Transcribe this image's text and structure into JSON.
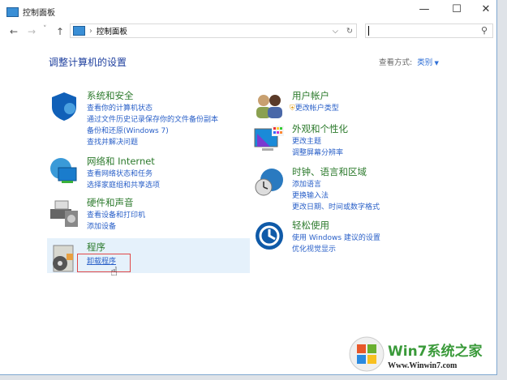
{
  "window": {
    "title": "控制面板",
    "minimize": "—",
    "maximize": "☐",
    "close": "✕"
  },
  "nav": {
    "back": "←",
    "forward": "→",
    "recent": "˅",
    "up": "↑",
    "address": "控制面板",
    "separator": "›",
    "dropdown": "⌵",
    "refresh": "↻",
    "search_placeholder": "",
    "search_icon": "⚲"
  },
  "main": {
    "heading": "调整计算机的设置",
    "view_label": "查看方式:",
    "view_value": "类别",
    "categories": [
      {
        "title": "系统和安全",
        "links": [
          "查看你的计算机状态",
          "通过文件历史记录保存你的文件备份副本",
          "备份和还原(Windows 7)",
          "查找并解决问题"
        ]
      },
      {
        "title": "网络和 Internet",
        "links": [
          "查看网络状态和任务",
          "选择家庭组和共享选项"
        ]
      },
      {
        "title": "硬件和声音",
        "links": [
          "查看设备和打印机",
          "添加设备"
        ]
      },
      {
        "title": "程序",
        "links": [
          "卸载程序"
        ]
      },
      {
        "title": "用户帐户",
        "links": [
          "更改帐户类型"
        ]
      },
      {
        "title": "外观和个性化",
        "links": [
          "更改主题",
          "调整屏幕分辨率"
        ]
      },
      {
        "title": "时钟、语言和区域",
        "links": [
          "添加语言",
          "更换输入法",
          "更改日期、时间或数字格式"
        ]
      },
      {
        "title": "轻松使用",
        "links": [
          "使用 Windows 建议的设置",
          "优化视觉显示"
        ]
      }
    ]
  },
  "watermark": {
    "brand": "Win7系统之家",
    "url": "Www.Winwin7.com"
  },
  "colors": {
    "heading": "#1e3f9e",
    "category": "#2c7a2c",
    "link": "#2a60c8",
    "highlight": "#e5f1fb"
  }
}
